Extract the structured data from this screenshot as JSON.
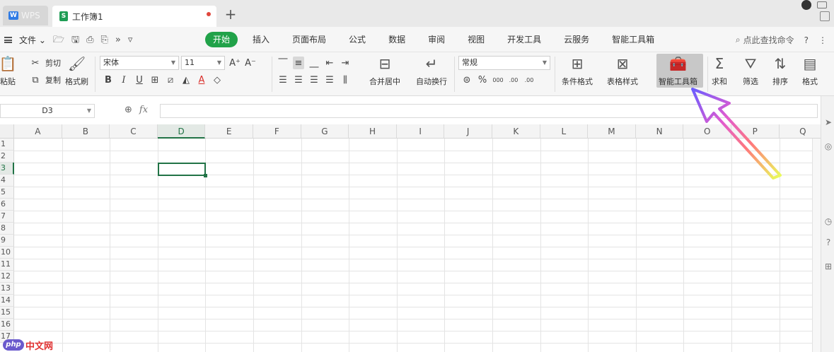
{
  "titlebar": {
    "app_tab_label": "WPS",
    "doc_tab_label": "工作簿1",
    "new_tab_symbol": "+",
    "doc_icon_letter": "S",
    "app_logo_letter": "W"
  },
  "menubar": {
    "file_label": "文件",
    "file_caret": "⌄",
    "more_symbol": "»",
    "tabs": [
      {
        "label": "开始",
        "active": true
      },
      {
        "label": "插入"
      },
      {
        "label": "页面布局"
      },
      {
        "label": "公式"
      },
      {
        "label": "数据"
      },
      {
        "label": "审阅"
      },
      {
        "label": "视图"
      },
      {
        "label": "开发工具"
      },
      {
        "label": "云服务"
      },
      {
        "label": "智能工具箱"
      }
    ],
    "search_label": "点此查找命令",
    "help_symbol": "?",
    "more_menu_symbol": "⋮"
  },
  "ribbon": {
    "paste_label": "粘贴",
    "cut_label": "剪切",
    "copy_label": "复制",
    "format_painter_label": "格式刷",
    "font_name": "宋体",
    "font_size": "11",
    "bold_symbol": "B",
    "italic_symbol": "I",
    "underline_symbol": "U",
    "grow_font_symbol": "A⁺",
    "shrink_font_symbol": "A⁻",
    "font_color_symbol": "A",
    "merge_center_label": "合并居中",
    "wrap_text_label": "自动换行",
    "number_format": "常规",
    "percent_symbol": "%",
    "thousands_symbol": "000",
    "inc_decimal_symbol": ".00",
    "dec_decimal_symbol": ".00",
    "cond_format_label": "条件格式",
    "table_style_label": "表格样式",
    "smart_toolbox_label": "智能工具箱",
    "sum_label": "求和",
    "filter_label": "筛选",
    "sort_label": "排序",
    "format_label": "格式",
    "sum_symbol": "Σ"
  },
  "formulabar": {
    "name_box": "D3",
    "fx_label": "fx",
    "formula_value": ""
  },
  "grid": {
    "columns": [
      "A",
      "B",
      "C",
      "D",
      "E",
      "F",
      "G",
      "H",
      "I",
      "J",
      "K",
      "L",
      "M",
      "N",
      "O",
      "P",
      "Q"
    ],
    "rows": [
      "1",
      "2",
      "3",
      "4",
      "5",
      "6",
      "7",
      "8",
      "9",
      "10",
      "11",
      "12",
      "13",
      "14",
      "15",
      "16",
      "17"
    ],
    "active_column": "D",
    "active_row": "3"
  },
  "watermark": {
    "logo_text": "php",
    "site_text": "中文网"
  },
  "colors": {
    "accent_green": "#21a249",
    "selection_green": "#217346",
    "highlight_gray": "#c8c8c8"
  }
}
